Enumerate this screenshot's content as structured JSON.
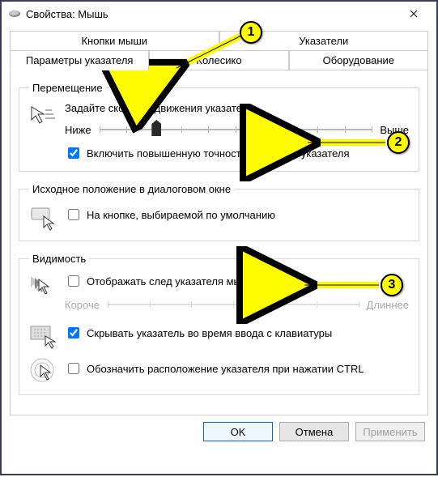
{
  "window": {
    "title": "Свойства: Мышь"
  },
  "tabs": {
    "row1": [
      "Кнопки мыши",
      "Указатели"
    ],
    "row2": [
      "Параметры указателя",
      "Колесико",
      "Оборудование"
    ],
    "active": "Параметры указателя"
  },
  "groups": {
    "motion": {
      "legend": "Перемещение",
      "prompt": "Задайте скорость движения указателя:",
      "slow": "Ниже",
      "fast": "Выше",
      "enhance": "Включить повышенную точность установки указателя",
      "enhance_checked": true,
      "slider_pos": 0.21
    },
    "snap": {
      "legend": "Исходное положение в диалоговом окне",
      "label": "На кнопке, выбираемой по умолчанию",
      "checked": false
    },
    "visibility": {
      "legend": "Видимость",
      "trail_label": "Отображать след указателя мыши",
      "trail_checked": false,
      "trail_short": "Короче",
      "trail_long": "Длиннее",
      "trail_pos": 0.6,
      "hide_label": "Скрывать указатель во время ввода с клавиатуры",
      "hide_checked": true,
      "locate_label": "Обозначить расположение указателя при нажатии CTRL",
      "locate_checked": false
    }
  },
  "buttons": {
    "ok": "OK",
    "cancel": "Отмена",
    "apply": "Применить"
  },
  "annotations": {
    "a1": "1",
    "a2": "2",
    "a3": "3"
  }
}
